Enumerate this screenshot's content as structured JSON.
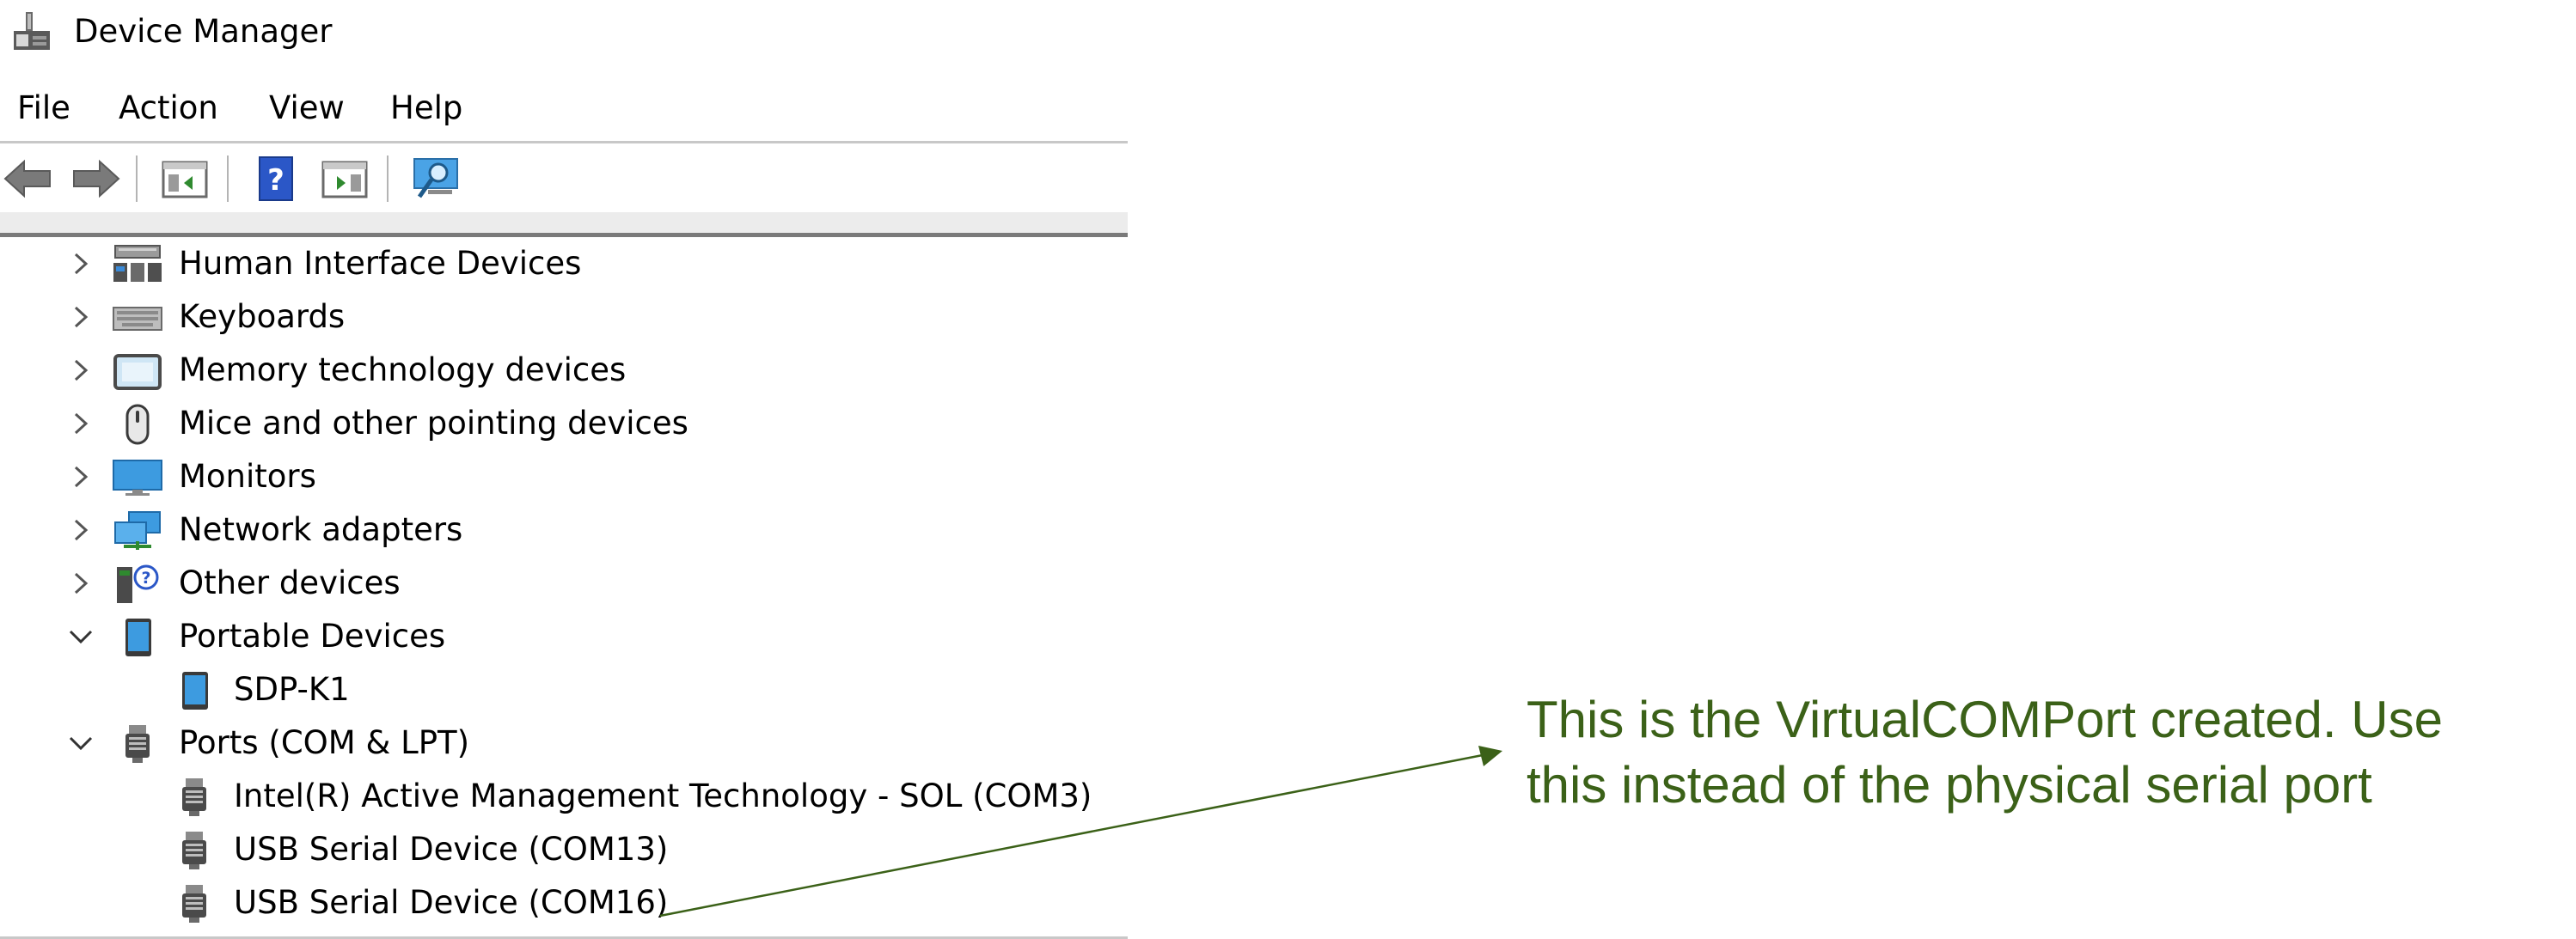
{
  "window": {
    "title": "Device Manager",
    "icon": "device-manager-icon"
  },
  "menu": {
    "file": "File",
    "action": "Action",
    "view": "View",
    "help": "Help"
  },
  "toolbar": {
    "buttons": [
      "back-icon",
      "forward-icon",
      "show-hide-console-tree-icon",
      "help-icon",
      "show-action-pane-icon",
      "scan-hardware-icon"
    ]
  },
  "tree": {
    "human_interface_devices": "Human Interface Devices",
    "keyboards": "Keyboards",
    "memory_technology_devices": "Memory technology devices",
    "mice": "Mice and other pointing devices",
    "monitors": "Monitors",
    "network_adapters": "Network adapters",
    "other_devices": "Other devices",
    "portable_devices": "Portable Devices",
    "sdp_k1": "SDP-K1",
    "ports": "Ports (COM & LPT)",
    "port_com3": "Intel(R) Active Management Technology - SOL (COM3)",
    "port_com13": "USB Serial Device (COM13)",
    "port_com16": "USB Serial Device (COM16)"
  },
  "annotation": {
    "line1": "This is the VirtualCOMPort created. Use",
    "line2": "this instead of the physical serial port",
    "color": "#3b6118"
  }
}
